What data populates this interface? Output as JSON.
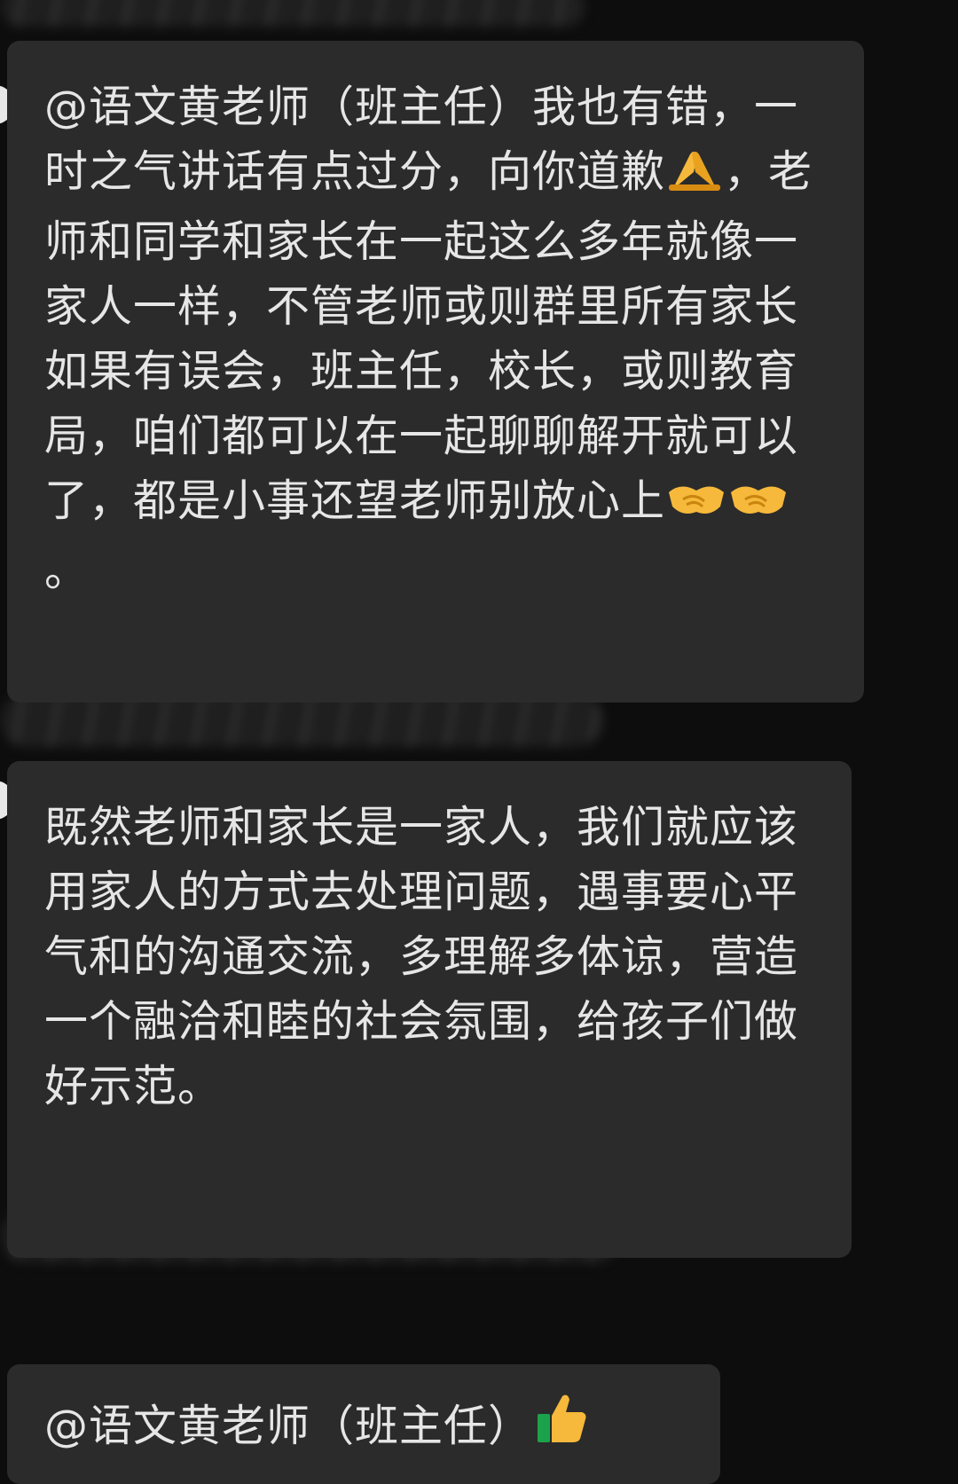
{
  "messages": [
    {
      "segments": [
        {
          "text": "@语文黄老师（班主任）我也有错，一时之气讲话有点过分，向你道歉"
        },
        {
          "emoji": "folded-hands"
        },
        {
          "text": "，老师和同学和家长在一起这么多年就像一家人一样，不管老师或则群里所有家长如果有误会，班主任，校长，或则教育局，咱们都可以在一起聊聊解开就可以了，都是小事还望老师别放心上"
        },
        {
          "emoji": "handshake"
        },
        {
          "emoji": "handshake"
        },
        {
          "text": "。"
        }
      ]
    },
    {
      "segments": [
        {
          "text": "既然老师和家长是一家人，我们就应该用家人的方式去处理问题，遇事要心平气和的沟通交流，多理解多体谅，营造一个融洽和睦的社会氛围，给孩子们做好示范。"
        }
      ]
    },
    {
      "segments": [
        {
          "text": "@语文黄老师（班主任）"
        },
        {
          "emoji": "thumbs-up"
        }
      ]
    }
  ],
  "colors": {
    "background": "#0d0d0d",
    "bubble": "#2b2b2b",
    "text": "#e6e6e6",
    "emoji_skin": "#f6b93b"
  }
}
